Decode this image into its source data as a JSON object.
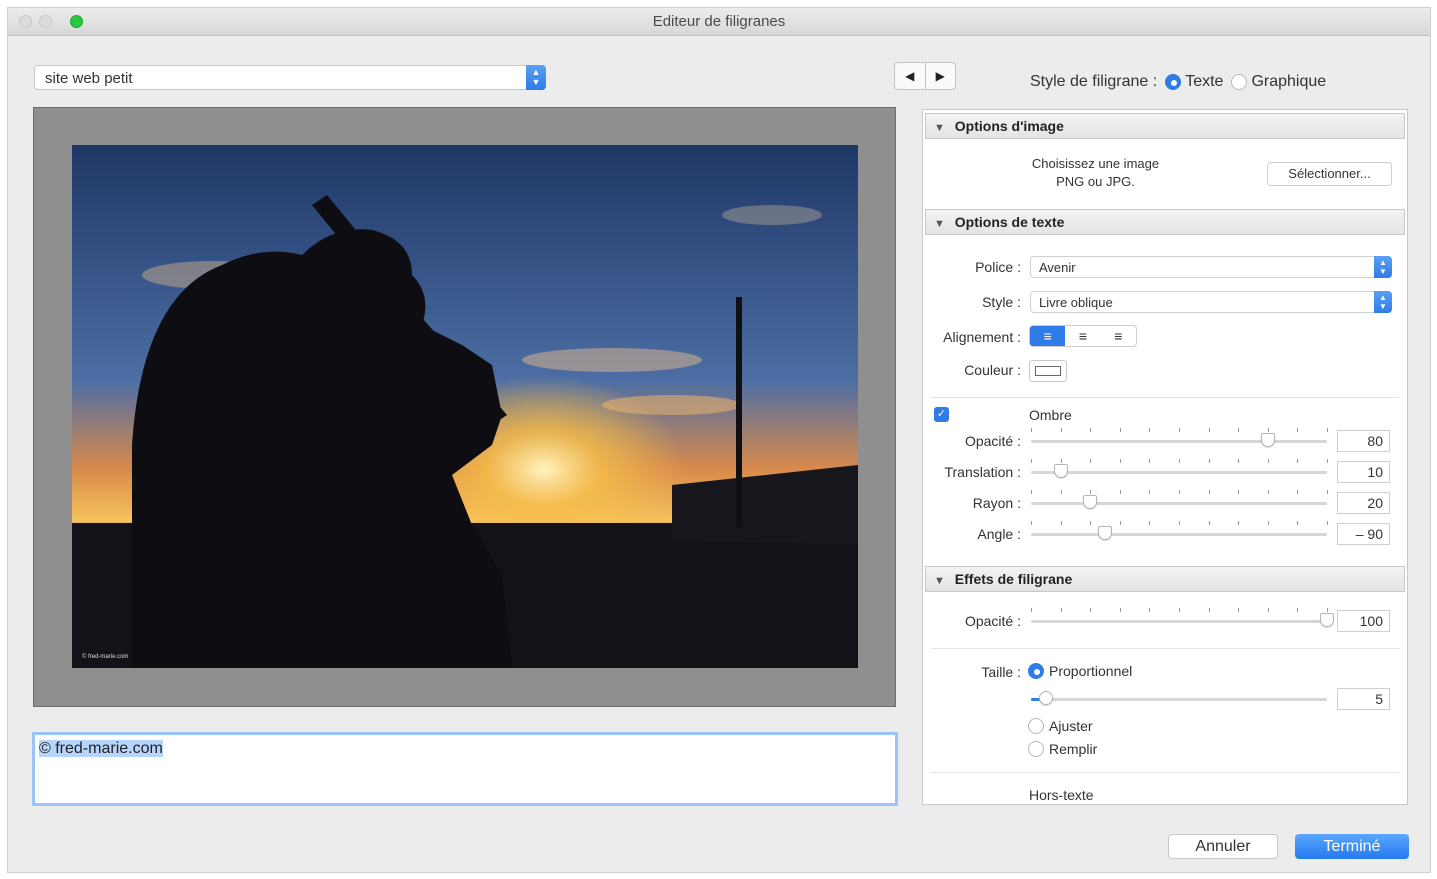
{
  "window": {
    "title": "Editeur de filigranes"
  },
  "preset": {
    "value": "site web petit"
  },
  "preview": {
    "watermark_text": "© fred-marie.com"
  },
  "text_input": {
    "value": "© fred-marie.com"
  },
  "nav": {
    "prev": "◀",
    "next": "▶"
  },
  "watermark_style": {
    "label": "Style de filigrane :",
    "text_option": "Texte",
    "graphic_option": "Graphique",
    "selected": "Texte"
  },
  "image_options": {
    "header": "Options d'image",
    "hint_line1": "Choisissez une image",
    "hint_line2": "PNG ou JPG.",
    "select_button": "Sélectionner..."
  },
  "text_options": {
    "header": "Options de texte",
    "font_label": "Police :",
    "font_value": "Avenir",
    "style_label": "Style :",
    "style_value": "Livre oblique",
    "align_label": "Alignement :",
    "color_label": "Couleur :",
    "shadow_label": "Ombre",
    "shadow_checked": true,
    "opacity_label": "Opacité :",
    "opacity_value": "80",
    "opacity_level": 0.8,
    "offset_label": "Translation :",
    "offset_value": "10",
    "offset_level": 0.1,
    "radius_label": "Rayon :",
    "radius_value": "20",
    "radius_level": 0.2,
    "angle_label": "Angle :",
    "angle_value": "– 90",
    "angle_level": 0.25
  },
  "effects": {
    "header": "Effets de filigrane",
    "opacity_label": "Opacité :",
    "opacity_value": "100",
    "opacity_level": 1.0,
    "size_label": "Taille :",
    "proportional": "Proportionnel",
    "size_value": "5",
    "size_level": 0.05,
    "fit": "Ajuster",
    "fill": "Remplir",
    "inset_label": "Hors-texte"
  },
  "footer": {
    "cancel": "Annuler",
    "done": "Terminé"
  },
  "colors": {
    "accent": "#2f7be8"
  },
  "icons": {
    "align_left": "≡",
    "align_center": "≡",
    "align_right": "≡",
    "triangle": "▼",
    "check": "✓"
  }
}
